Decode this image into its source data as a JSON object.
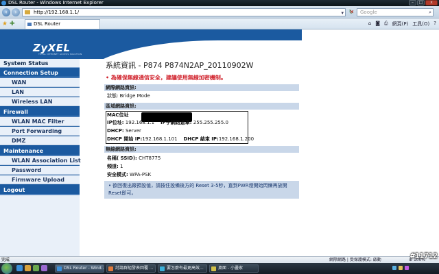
{
  "window": {
    "title": "DSL Router - Windows Internet Explorer",
    "url": "http://192.168.1.1/",
    "search_placeholder": "Google",
    "tab_label": "DSL Router",
    "toolbar_page": "網頁(P)",
    "toolbar_tools": "工具(O)"
  },
  "banner": {
    "logo": "ZyXEL",
    "logo_sub": "TOTAL INTERNET ACCESS SOLUTION"
  },
  "sidebar": {
    "items": [
      {
        "label": "System Status",
        "kind": "active"
      },
      {
        "label": "Connection Setup",
        "kind": "head"
      },
      {
        "label": "WAN",
        "kind": "sub"
      },
      {
        "label": "LAN",
        "kind": "sub"
      },
      {
        "label": "Wireless LAN",
        "kind": "sub"
      },
      {
        "label": "Firewall",
        "kind": "head"
      },
      {
        "label": "WLAN MAC Filter",
        "kind": "sub"
      },
      {
        "label": "Port Forwarding",
        "kind": "sub"
      },
      {
        "label": "DMZ",
        "kind": "sub"
      },
      {
        "label": "Maintenance",
        "kind": "head"
      },
      {
        "label": "WLAN Association List",
        "kind": "sub"
      },
      {
        "label": "Password",
        "kind": "sub"
      },
      {
        "label": "Firmware Upload",
        "kind": "sub"
      },
      {
        "label": "Logout",
        "kind": "head"
      }
    ]
  },
  "main": {
    "title": "系統資訊 - P874   P874N2AP_20110902W",
    "warning": "為確保無線通信安全，建議使用無線加密機制。",
    "wan": {
      "header": "網際網路資訊:",
      "status_label": "狀態:",
      "status_value": "Bridge Mode"
    },
    "lan": {
      "header": "區域網路資訊:",
      "mac_label": "MAC位址",
      "ip_label": "IP位址:",
      "ip_value": "192.168.1.1",
      "mask_label": "IP子網路遮罩:",
      "mask_value": "255.255.255.0",
      "dhcp_label": "DHCP:",
      "dhcp_value": "Server",
      "dhcp_start_label": "DHCP 開始 IP:",
      "dhcp_start_value": "192.168.1.101",
      "dhcp_end_label": "DHCP 結束 IP:",
      "dhcp_end_value": "192.168.1.200"
    },
    "wlan": {
      "header": "無線網路資訊:",
      "ssid_label": "名稱( SSID):",
      "ssid_value": "CHT8775",
      "channel_label": "頻道:",
      "channel_value": "1",
      "security_label": "安全模式:",
      "security_value": "WPA-PSK"
    },
    "note": "欲回復出廠預設值，請按住設備後方的 Reset 3-5秒，直到PWR燈開始閃爍再放開Reset即可。"
  },
  "statusbar": {
    "left": "完成",
    "zone": "網際網路 | 受保護模式: 啟動",
    "zoom": "100%"
  },
  "taskbar": {
    "buttons": [
      {
        "label": "DSL Router - Wind...",
        "active": true
      },
      {
        "label": "討論群組發表回覆 ...",
        "active": false
      },
      {
        "label": "要怎麼有最更高效...",
        "active": false
      },
      {
        "label": "桌面 - 小畫家",
        "active": false
      }
    ]
  },
  "watermark": "#11712"
}
